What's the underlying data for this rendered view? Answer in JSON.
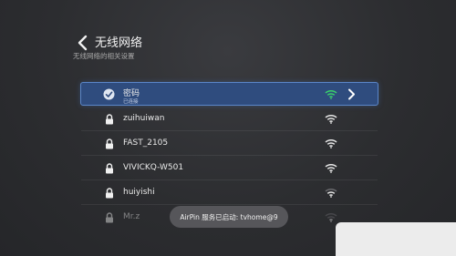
{
  "header": {
    "title": "无线网络",
    "subtitle": "无线网络的相关设置"
  },
  "networks": [
    {
      "name": "密码",
      "status": "已连接",
      "icon": "check-icon",
      "signal": "strong",
      "wifi_color": "#3ad16b"
    },
    {
      "name": "zuihuiwan",
      "icon": "lock-icon",
      "signal": "strong",
      "wifi_color": "#e8e8e8"
    },
    {
      "name": "FAST_2105",
      "icon": "lock-icon",
      "signal": "strong",
      "wifi_color": "#e8e8e8"
    },
    {
      "name": "VIVICKQ-W501",
      "icon": "lock-icon",
      "signal": "strong",
      "wifi_color": "#e8e8e8"
    },
    {
      "name": "huiyishi",
      "icon": "lock-icon",
      "signal": "medium",
      "wifi_color": "#e8e8e8"
    },
    {
      "name": "Mr.z",
      "icon": "lock-icon",
      "signal": "weak",
      "wifi_color": "#e8e8e8"
    }
  ],
  "toast": {
    "text": "AirPin 服务已启动:  tvhome@9"
  },
  "colors": {
    "background": "#2c2d30",
    "selected_row": "#2f4c7e",
    "selected_border": "#5b86c8",
    "connected_wifi": "#3ad16b"
  }
}
